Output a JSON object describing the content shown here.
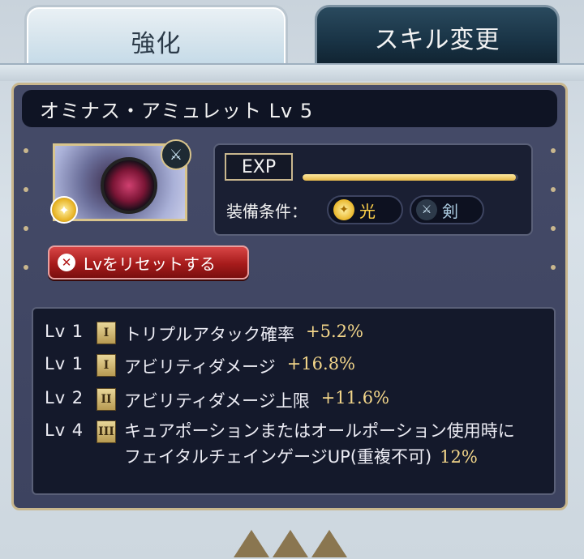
{
  "tabs": {
    "active": "強化",
    "inactive": "スキル変更"
  },
  "item": {
    "name": "オミナス・アミュレット Lv 5"
  },
  "exp": {
    "label": "EXP",
    "progress": 0.99
  },
  "equip": {
    "label": "装備条件：",
    "element": "光",
    "weapon": "剣"
  },
  "reset_button": "Lvをリセットする",
  "skills": [
    {
      "lv": "Lv 1",
      "rank": "I",
      "name": "トリプルアタック確率",
      "value": "+5.2%"
    },
    {
      "lv": "Lv 1",
      "rank": "I",
      "name": "アビリティダメージ",
      "value": "+16.8%"
    },
    {
      "lv": "Lv 2",
      "rank": "II",
      "name": "アビリティダメージ上限",
      "value": "+11.6%"
    },
    {
      "lv": "Lv 4",
      "rank": "III",
      "name": "キュアポーションまたはオールポーション使用時にフェイタルチェインゲージUP(重複不可)",
      "value": "12%"
    }
  ],
  "colors": {
    "accent_gold": "#c9b78e",
    "value_gold": "#f3d68a",
    "reset_red": "#b21b1b"
  }
}
